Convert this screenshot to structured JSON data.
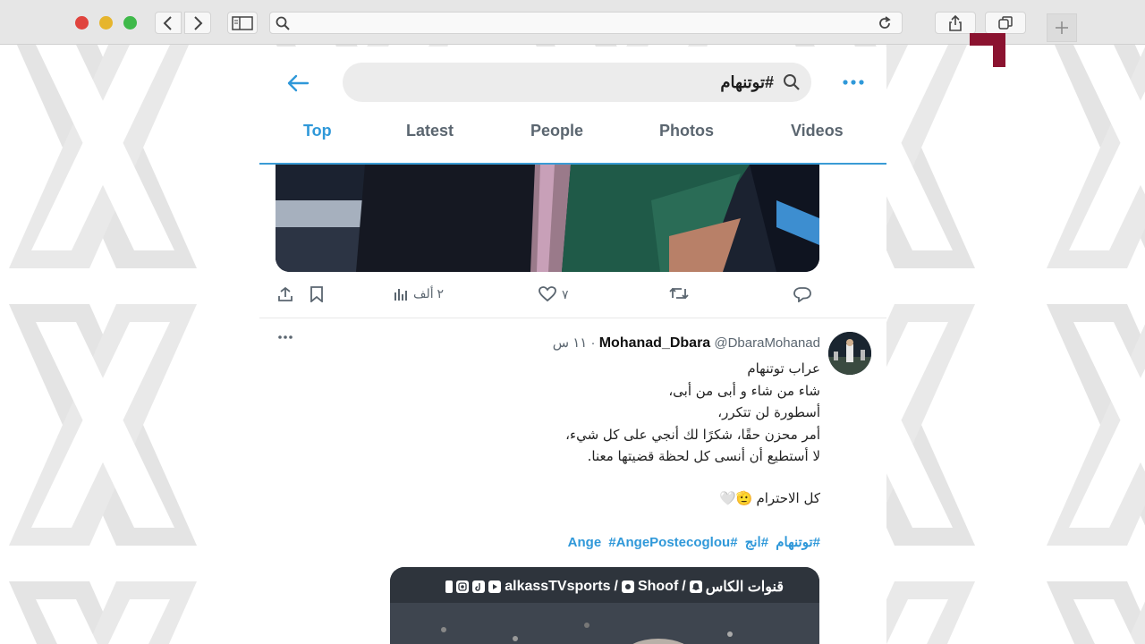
{
  "browser": {
    "url_text": ""
  },
  "search": {
    "query": "#توتنهام"
  },
  "tabs": [
    {
      "label": "Top",
      "active": true
    },
    {
      "label": "Latest",
      "active": false
    },
    {
      "label": "People",
      "active": false
    },
    {
      "label": "Photos",
      "active": false
    },
    {
      "label": "Videos",
      "active": false
    }
  ],
  "first_tweet": {
    "views": "٢ ألف",
    "likes": "٧",
    "retweets": "",
    "replies": ""
  },
  "tweet": {
    "display_name": "Mohanad_Dbara",
    "handle": "@DbaraMohanad",
    "separator": "·",
    "time": "١١ س",
    "lines": [
      "عراب توتنهام",
      "شاء من شاء و أبى من أبى،",
      "أسطورة لن تتكرر،",
      "أمر محزن حقًا، شكرًا لك أنجي على كل شيء،",
      "لا أستطيع أن أنسى كل لحظة قضيتها معنا."
    ],
    "respect": "كل الاحترام",
    "respect_emoji": "🫡🤍",
    "hashtags": [
      "#توتنهام",
      "#انج",
      "#Ange",
      "#AngePostecoglou"
    ]
  },
  "media_watermark": {
    "channel": "قنوات الكاس",
    "shoof": "Shoof",
    "social": "alkassTVsports",
    "sep": "/"
  },
  "colors": {
    "accent": "#2f98d9",
    "logo": "#8b1330",
    "header_line": "#3a9bd5"
  },
  "icons": [
    "back-arrow-icon",
    "search-icon",
    "more-icon",
    "share-icon",
    "bookmark-icon",
    "views-icon",
    "like-icon",
    "retweet-icon",
    "reply-icon",
    "reload-icon",
    "tabs-icon",
    "plus-icon",
    "sidebar-icon"
  ]
}
